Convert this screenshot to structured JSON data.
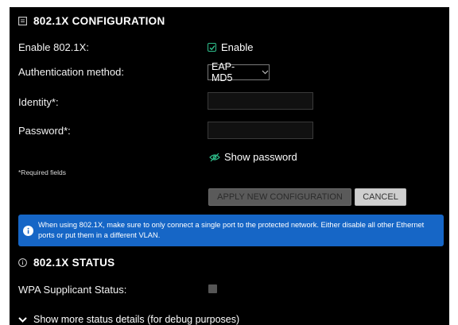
{
  "config": {
    "title": "802.1X CONFIGURATION",
    "enable_label": "Enable 802.1X:",
    "enable_checkbox_text": "Enable",
    "auth_label": "Authentication method:",
    "auth_value": "EAP-MD5",
    "identity_label": "Identity*:",
    "identity_value": "",
    "password_label": "Password*:",
    "password_value": "",
    "show_password": "Show password",
    "required_note": "*Required fields",
    "apply_button": "APPLY NEW CONFIGURATION",
    "cancel_button": "CANCEL",
    "info_text": "When using 802.1X, make sure to only connect a single port to the protected network. Either disable all other Ethernet ports or put them in a different VLAN."
  },
  "status": {
    "title": "802.1X STATUS",
    "wpa_label": "WPA Supplicant Status:",
    "more_details": "Show more status details (for debug purposes)"
  },
  "colors": {
    "panel_bg": "#000000",
    "accent_green": "#2fbf8c",
    "info_blue": "#1666c6"
  },
  "icons": [
    "config-icon",
    "checkbox-checked-icon",
    "chevron-down-icon",
    "eye-off-icon",
    "info-icon",
    "status-info-icon",
    "expand-chevron-icon"
  ]
}
